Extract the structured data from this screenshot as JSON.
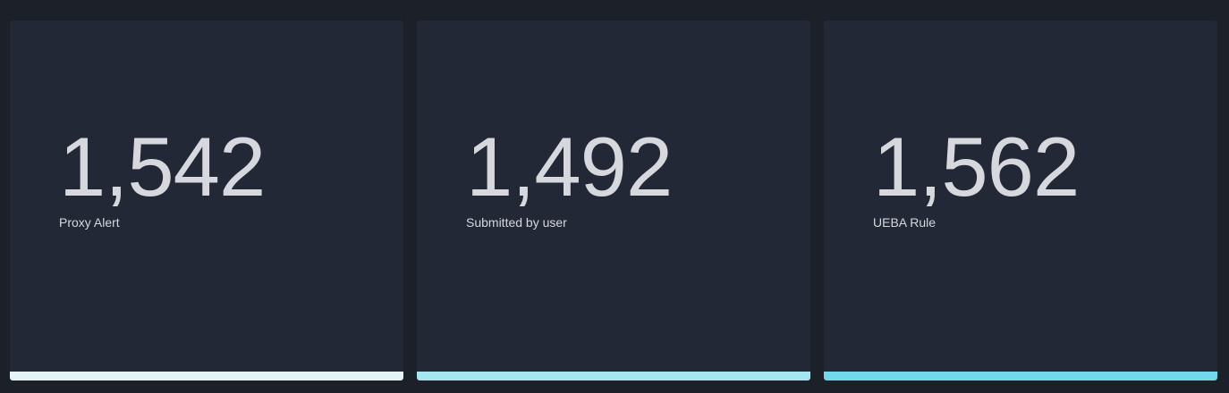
{
  "stats": [
    {
      "value": "1,542",
      "label": "Proxy Alert",
      "accent": "#e6f3f6"
    },
    {
      "value": "1,492",
      "label": "Submitted by user",
      "accent": "#a5e6f0"
    },
    {
      "value": "1,562",
      "label": "UEBA Rule",
      "accent": "#72d9ec"
    }
  ],
  "colors": {
    "background": "#1c2029",
    "panel": "#232837",
    "text": "#d6d8dd"
  }
}
